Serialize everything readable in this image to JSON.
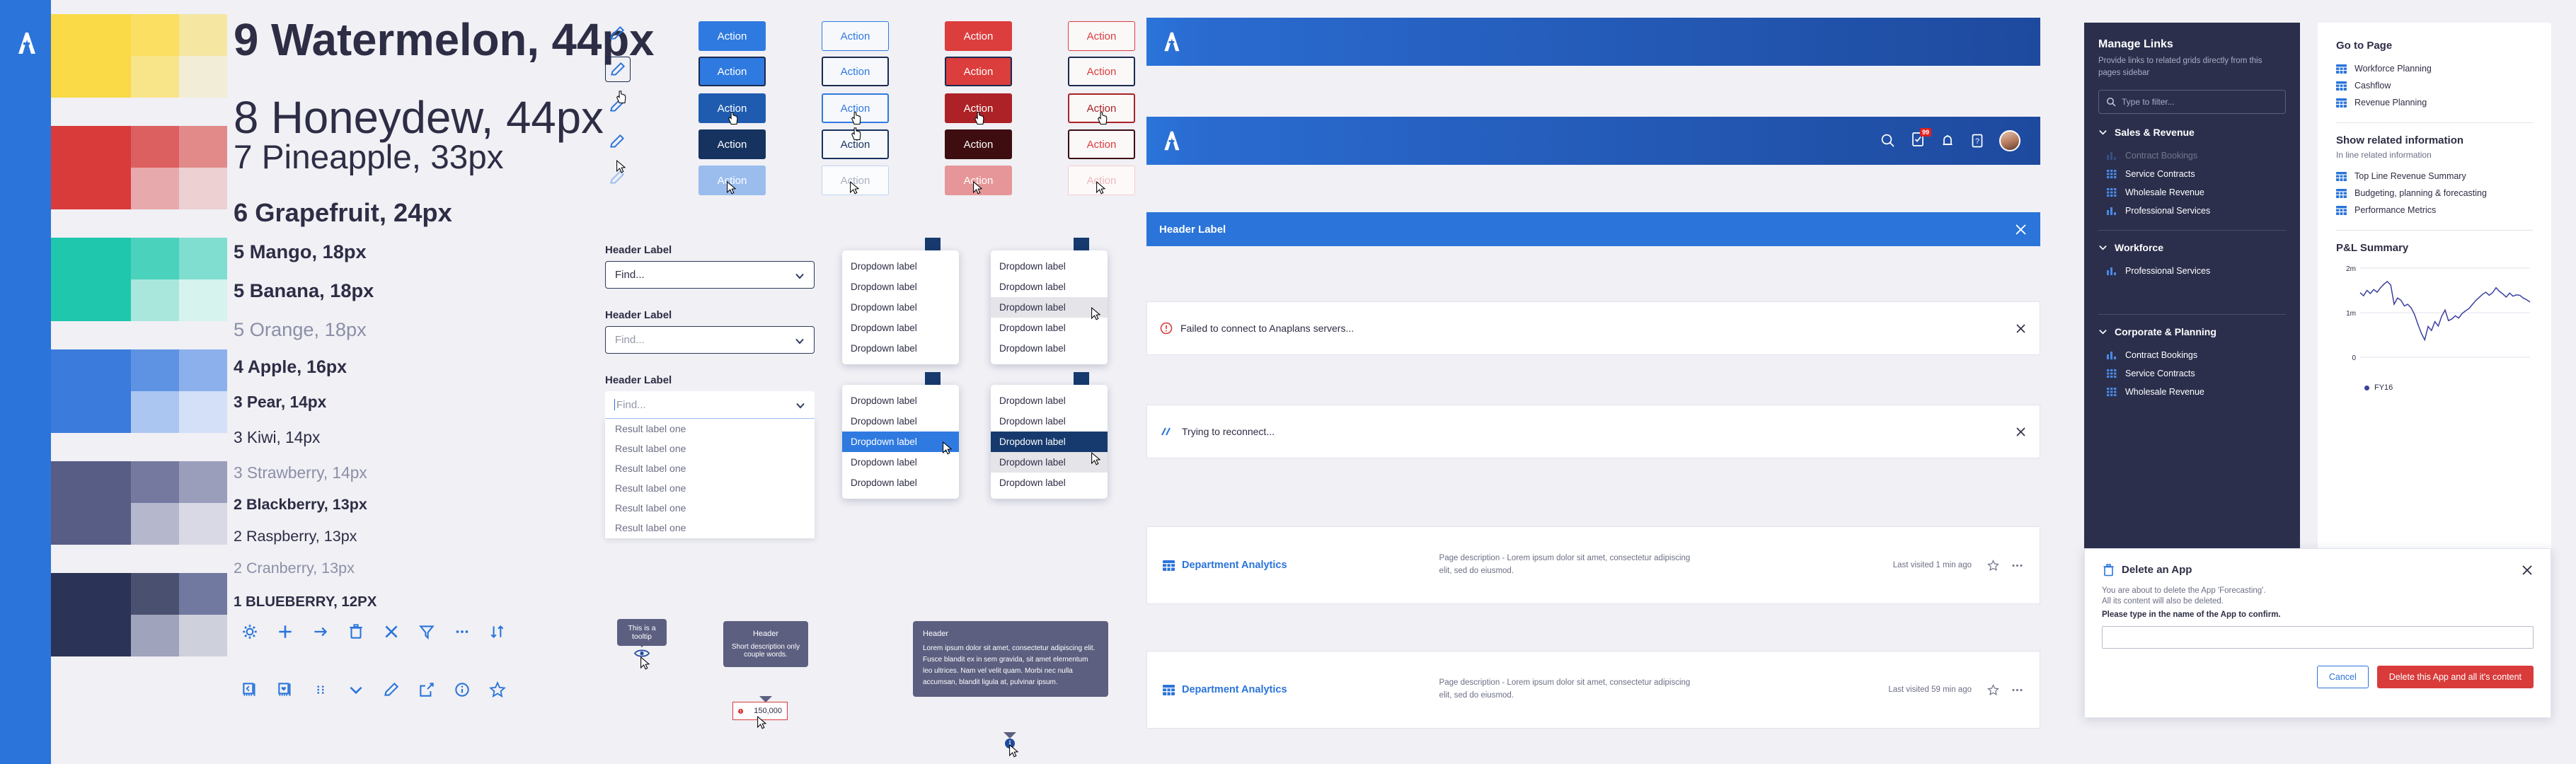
{
  "brand": {
    "accent_blue": "#2a74da",
    "accent_blue_dark": "#1e4a9e",
    "navy": "#1b2a4e",
    "red": "#d93b3b",
    "red_dark": "#9e1f24",
    "bg": "#f0f0f5",
    "ink": "#2d2d45"
  },
  "swatches": [
    {
      "name": "yellow",
      "base": "#fada47",
      "tints": [
        "#fadf62",
        "#f5e6a2",
        "#f8e589",
        "#f2edd7"
      ]
    },
    {
      "name": "red",
      "base": "#d93b3b",
      "tints": [
        "#dd6060",
        "#e28a8a",
        "#e8a9ac",
        "#edd0d2"
      ]
    },
    {
      "name": "teal",
      "base": "#1fc7ac",
      "tints": [
        "#4bd2bd",
        "#7fdecf",
        "#a9e7dd",
        "#d6f3ee"
      ]
    },
    {
      "name": "blue",
      "base": "#3a7bdc",
      "tints": [
        "#5e93e3",
        "#8bb0eb",
        "#aac6f1",
        "#d3e0f8"
      ]
    },
    {
      "name": "purple",
      "base": "#585d85",
      "tints": [
        "#7579a0",
        "#9b9ebb",
        "#b5b7cd",
        "#d8d9e4"
      ]
    },
    {
      "name": "navy",
      "base": "#2b3356",
      "tints": [
        "#4a5170",
        "#7279a0",
        "#9fa3bb",
        "#ced0dc"
      ]
    }
  ],
  "typography": [
    {
      "label": "9 Watermelon, 44px",
      "size": 28,
      "weight": "bold",
      "color": "#2d2d45"
    },
    {
      "label": "8 Honeydew, 44px",
      "size": 28,
      "weight": "normal",
      "color": "#2d2d45"
    },
    {
      "label": "7 Pineapple, 33px",
      "size": 21,
      "weight": "normal",
      "color": "#2d2d45"
    },
    {
      "label": "6 Grapefruit, 24px",
      "size": 16,
      "weight": "bold",
      "color": "#2d2d45"
    },
    {
      "label": "5 Mango, 18px",
      "size": 12,
      "weight": "bold",
      "color": "#2d2d45"
    },
    {
      "label": "5 Banana, 18px",
      "size": 12,
      "weight": "bold",
      "color": "#2d2d45"
    },
    {
      "label": "5 Orange, 18px",
      "size": 12,
      "weight": "normal",
      "color": "#8b8fa6"
    },
    {
      "label": "4 Apple, 16px",
      "size": 11,
      "weight": "bold",
      "color": "#2d2d45"
    },
    {
      "label": "3 Pear, 14px",
      "size": 10,
      "weight": "bold",
      "color": "#2d2d45"
    },
    {
      "label": "3 Kiwi, 14px",
      "size": 10,
      "weight": "normal",
      "color": "#2d2d45"
    },
    {
      "label": "3 Strawberry, 14px",
      "size": 10,
      "weight": "normal",
      "color": "#8b8fa6"
    },
    {
      "label": "2 Blackberry, 13px",
      "size": 9.5,
      "weight": "bold",
      "color": "#2d2d45"
    },
    {
      "label": "2 Raspberry, 13px",
      "size": 9.5,
      "weight": "normal",
      "color": "#2d2d45"
    },
    {
      "label": "2 Cranberry, 13px",
      "size": 9.5,
      "weight": "normal",
      "color": "#8b8fa6"
    },
    {
      "label": "1 BLUEBERRY, 12PX",
      "size": 9,
      "weight": "bold",
      "color": "#2d2d45"
    }
  ],
  "buttons": {
    "label": "Action",
    "columns": [
      {
        "name": "primary-blue",
        "states": [
          {
            "state": "default",
            "bg": "#2f7ae0",
            "fg": "#ffffff",
            "border": "none"
          },
          {
            "state": "focus",
            "bg": "#2f7ae0",
            "fg": "#ffffff",
            "border": "2px solid #1b2a4e"
          },
          {
            "state": "hover",
            "bg": "#1f5cb0",
            "fg": "#ffffff",
            "border": "none"
          },
          {
            "state": "active",
            "bg": "#16335f",
            "fg": "#ffffff",
            "border": "none"
          },
          {
            "state": "disabled",
            "bg": "#9bbdee",
            "fg": "#ffffff",
            "border": "none"
          }
        ]
      },
      {
        "name": "secondary-blue",
        "states": [
          {
            "state": "default",
            "bg": "#f7f8fc",
            "fg": "#2f7ae0",
            "border": "1px solid #2f7ae0"
          },
          {
            "state": "focus",
            "bg": "#f7f8fc",
            "fg": "#2f7ae0",
            "border": "2px solid #1b2a4e"
          },
          {
            "state": "hover",
            "bg": "#f7f8fc",
            "fg": "#2f7ae0",
            "border": "2px solid #2f7ae0"
          },
          {
            "state": "active",
            "bg": "#f7f8fc",
            "fg": "#16335f",
            "border": "2px solid #16335f"
          },
          {
            "state": "disabled",
            "bg": "#fbfcfe",
            "fg": "#aab0c4",
            "border": "1px solid #bfd3f2"
          }
        ]
      },
      {
        "name": "primary-red",
        "states": [
          {
            "state": "default",
            "bg": "#dc3d3d",
            "fg": "#ffffff",
            "border": "none"
          },
          {
            "state": "focus",
            "bg": "#dc3d3d",
            "fg": "#ffffff",
            "border": "2px solid #1b2a4e"
          },
          {
            "state": "hover",
            "bg": "#ac2226",
            "fg": "#ffffff",
            "border": "none"
          },
          {
            "state": "active",
            "bg": "#3d0d10",
            "fg": "#ffffff",
            "border": "none"
          },
          {
            "state": "disabled",
            "bg": "#e69698",
            "fg": "#ffffff",
            "border": "none"
          }
        ]
      },
      {
        "name": "secondary-red",
        "states": [
          {
            "state": "default",
            "bg": "#fbf8f8",
            "fg": "#dc3d3d",
            "border": "1px solid #dc3d3d"
          },
          {
            "state": "focus",
            "bg": "#fbf8f8",
            "fg": "#dc3d3d",
            "border": "2px solid #1b2a4e"
          },
          {
            "state": "hover",
            "bg": "#fbf8f8",
            "fg": "#ac2226",
            "border": "2px solid #ac2226"
          },
          {
            "state": "active",
            "bg": "#fbf8f8",
            "fg": "#dc3d3d",
            "border": "2px solid #3d0d10"
          },
          {
            "state": "disabled",
            "bg": "#fdf9f9",
            "fg": "#eeb9bb",
            "border": "1px solid #f3cdce"
          }
        ]
      }
    ]
  },
  "forms": {
    "fields": [
      {
        "label": "Header Label",
        "value": "Find...",
        "state": "filled",
        "placeholder": "Find..."
      },
      {
        "label": "Header Label",
        "value": "",
        "state": "empty",
        "placeholder": "Find..."
      },
      {
        "label": "Header Label",
        "value": "",
        "state": "open",
        "placeholder": "Find..."
      }
    ],
    "result_label": "Result label one",
    "result_count": 6,
    "dropdown_label": "Dropdown label",
    "menus": [
      {
        "name": "default",
        "items": 5,
        "highlight_index": -1,
        "highlight_style": "none"
      },
      {
        "name": "hover",
        "items": 5,
        "highlight_index": 2,
        "highlight_style": "hover"
      },
      {
        "name": "selected",
        "items": 5,
        "highlight_index": 2,
        "highlight_style": "selected"
      },
      {
        "name": "selected-hover",
        "items": 5,
        "highlight_index": 2,
        "highlight_style": "active",
        "secondary_index": 3
      }
    ]
  },
  "icon_toolbar": {
    "row1": [
      "gear-icon",
      "plus-icon",
      "arrow-right-icon",
      "trash-icon",
      "close-icon",
      "filter-icon",
      "ellipsis-icon",
      "sort-icon"
    ],
    "row2": [
      "panel-collapse-icon",
      "panel-favorite-icon",
      "drag-handle-icon",
      "chevron-down-icon",
      "pencil-icon",
      "export-icon",
      "info-icon",
      "star-icon"
    ]
  },
  "tooltips": {
    "simple": {
      "text": "This is a tooltip",
      "anchor_icon": "eye-icon"
    },
    "header_card": {
      "header": "Header",
      "body": "Short description only couple words."
    },
    "error_field": {
      "value": "150,000",
      "icon": "error-icon"
    },
    "long_card": {
      "header": "Header",
      "body": "Lorem ipsum dolor sit amet, consectetur adipiscing elit. Fusce blandit ex in sem gravida, sit amet elementum leo ultrices. Nam vel velit quam. Morbi nec nulla accumsan, blandit ligula at, pulvinar ipsum.",
      "anchor_icon": "info-icon"
    }
  },
  "center": {
    "appbar": {
      "logo": "anaplan-logo",
      "icons": [
        "search-icon",
        "tasks-icon",
        "bell-icon",
        "help-icon"
      ],
      "badge": "99",
      "avatar": "avatar"
    },
    "header_panel": {
      "title": "Header Label",
      "close": "close-icon"
    },
    "banners": [
      {
        "icon": "error-icon",
        "text": "Failed to connect to Anaplans servers...",
        "close": "close-icon"
      },
      {
        "icon": "loading-icon",
        "text": "Trying to reconnect...",
        "close": "close-icon"
      }
    ],
    "cards": [
      {
        "icon": "grid-icon",
        "title": "Department Analytics",
        "description": "Page description - Lorem ipsum dolor sit amet, consectetur adipiscing elit, sed do eiusmod.",
        "meta": "Last visited 1 min ago",
        "star": "star-icon",
        "more": "ellipsis-icon"
      },
      {
        "icon": "grid-icon",
        "title": "Department Analytics",
        "description": "Page description - Lorem ipsum dolor sit amet, consectetur adipiscing elit, sed do eiusmod.",
        "meta": "Last visited 59 min ago",
        "star": "star-icon",
        "more": "ellipsis-icon"
      }
    ]
  },
  "manage_links": {
    "title": "Manage Links",
    "subtitle": "Provide links to related grids directly from this pages sidebar",
    "filter_placeholder": "Type to filter...",
    "groups": [
      {
        "name": "Sales & Revenue",
        "items": [
          {
            "label": "Contract Bookings",
            "icon": "chart-icon",
            "muted": true
          },
          {
            "label": "Service Contracts",
            "icon": "grid-icon",
            "muted": false
          },
          {
            "label": "Wholesale Revenue",
            "icon": "grid-icon",
            "muted": false
          },
          {
            "label": "Professional Services",
            "icon": "chart-icon",
            "muted": false
          }
        ]
      },
      {
        "name": "Workforce",
        "items": [
          {
            "label": "Professional Services",
            "icon": "chart-icon",
            "muted": false
          }
        ]
      },
      {
        "name": "Corporate & Planning",
        "items": [
          {
            "label": "Contract Bookings",
            "icon": "chart-icon",
            "muted": false
          },
          {
            "label": "Service Contracts",
            "icon": "grid-icon",
            "muted": false
          },
          {
            "label": "Wholesale Revenue",
            "icon": "grid-icon",
            "muted": false
          }
        ]
      }
    ]
  },
  "go_to_page": {
    "title": "Go to Page",
    "items": [
      "Workforce Planning",
      "Cashflow",
      "Revenue Planning"
    ],
    "related_title": "Show related information",
    "related_subtitle": "In line related information",
    "related_items": [
      "Top Line Revenue Summary",
      "Budgeting, planning & forecasting",
      "Performance Metrics"
    ]
  },
  "chart_data": {
    "type": "line",
    "title": "P&L Summary",
    "xlabel": "",
    "ylabel": "",
    "ylim": [
      0,
      2000000
    ],
    "ytick_labels": [
      "2m",
      "1m",
      "0"
    ],
    "ytick_values": [
      2000000,
      1000000,
      0
    ],
    "grid": true,
    "legend": [
      "FY16"
    ],
    "legend_position": "bottom",
    "series": [
      {
        "name": "FY16",
        "color": "#3b3f9e",
        "values": [
          1450000,
          1380000,
          1500000,
          1430000,
          1520000,
          1460000,
          1560000,
          1640000,
          1700000,
          1620000,
          1190000,
          1330000,
          1280000,
          1150000,
          1190000,
          1110000,
          960000,
          740000,
          540000,
          390000,
          690000,
          600000,
          800000,
          700000,
          920000,
          1060000,
          820000,
          860000,
          930000,
          880000,
          980000,
          1040000,
          1090000,
          1180000,
          1270000,
          1340000,
          1410000,
          1460000,
          1390000,
          1450000,
          1560000,
          1480000,
          1420000,
          1350000,
          1440000,
          1370000,
          1400000,
          1390000,
          1330000,
          1290000,
          1240000
        ]
      }
    ]
  },
  "delete_modal": {
    "icon": "trash-icon",
    "title": "Delete an App",
    "close": "close-icon",
    "line1": "You are about to delete the App 'Forecasting'.",
    "line2": "All its content will also be deleted.",
    "line3": "Please type in the name of the App to confirm.",
    "input_value": "",
    "cancel_label": "Cancel",
    "confirm_label": "Delete this App and all it's content"
  }
}
